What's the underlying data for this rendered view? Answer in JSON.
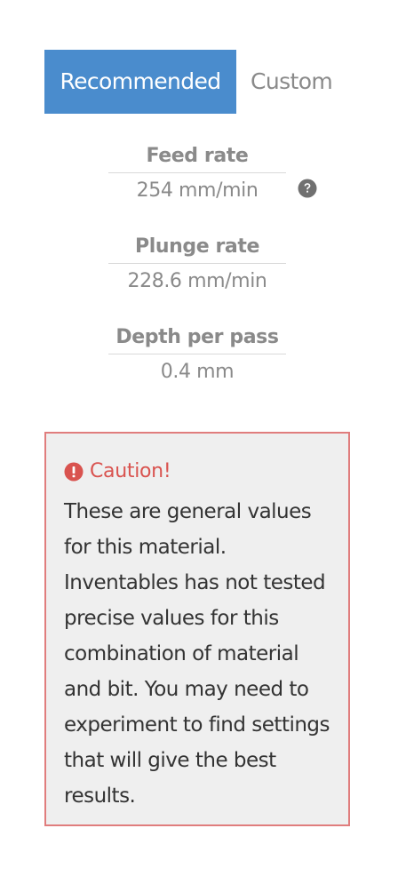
{
  "tabs": {
    "recommended": "Recommended",
    "custom": "Custom"
  },
  "fields": {
    "feed_rate": {
      "label": "Feed rate",
      "value": "254 mm/min"
    },
    "plunge_rate": {
      "label": "Plunge rate",
      "value": "228.6 mm/min"
    },
    "depth_per_pass": {
      "label": "Depth per pass",
      "value": "0.4 mm"
    }
  },
  "caution": {
    "title": "Caution!",
    "body": "These are general values for this material. Inventables has not tested precise values for this combination of material and bit. You may need to experiment to find settings that will give the best results."
  },
  "colors": {
    "active_tab": "#4a8ccd",
    "caution_border": "#e07d7d",
    "caution_text": "#d9534f",
    "muted_text": "#8a8a8a"
  },
  "icons": {
    "help": "question-circle-icon",
    "caution": "exclamation-circle-icon"
  }
}
